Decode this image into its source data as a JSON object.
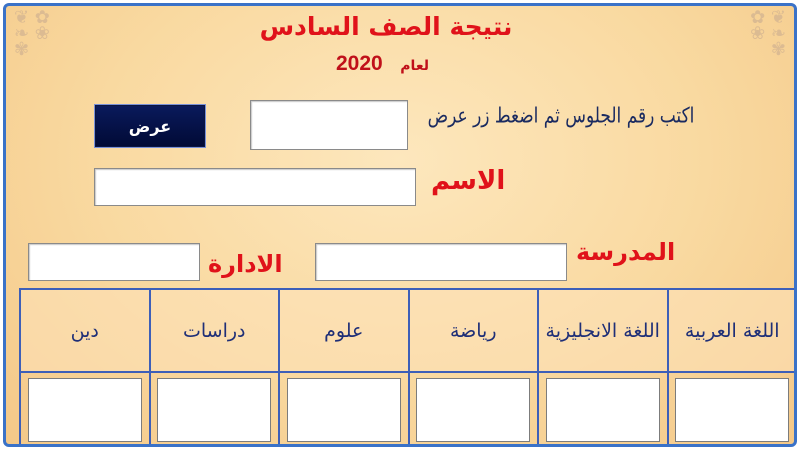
{
  "header": {
    "title": "نتيجة الصف السادس",
    "year_prefix": "لعام",
    "year": "2020"
  },
  "search": {
    "instruction": "اكتب رقم الجلوس ثم اضغط زر عرض",
    "seat_number_value": "",
    "show_button_label": "عرض"
  },
  "student": {
    "name_label": "الاسم",
    "name_value": "",
    "school_label": "المدرسة",
    "school_value": "",
    "administration_label": "الادارة",
    "administration_value": ""
  },
  "grades": {
    "headers": [
      "اللغة العربية",
      "اللغة الانجليزية",
      "رياضة",
      "علوم",
      "دراسات",
      "دين"
    ],
    "values": [
      "",
      "",
      "",
      "",
      "",
      ""
    ]
  },
  "colors": {
    "frame_border": "#3a72c8",
    "title_red": "#e0121a",
    "header_blue": "#1f2f77",
    "button_navy": "#0a1a5c"
  }
}
